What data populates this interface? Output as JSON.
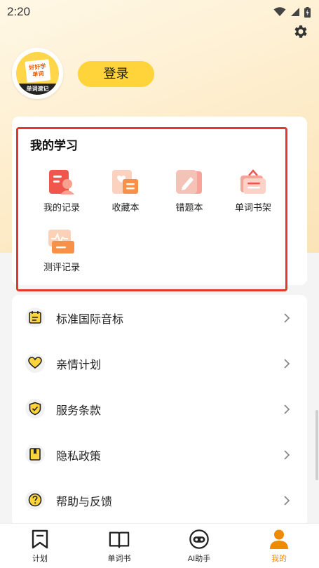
{
  "status_bar": {
    "time": "2:20"
  },
  "profile": {
    "avatar_top_text": "好好学",
    "avatar_mid_text": "单词",
    "avatar_band_text": "单词速记",
    "login_label": "登录"
  },
  "study": {
    "title": "我的学习",
    "items": [
      {
        "label": "我的记录",
        "icon": "record-icon"
      },
      {
        "label": "收藏本",
        "icon": "favorites-icon"
      },
      {
        "label": "错题本",
        "icon": "mistakes-icon"
      },
      {
        "label": "单词书架",
        "icon": "bookshelf-icon"
      },
      {
        "label": "测评记录",
        "icon": "assessment-icon"
      }
    ]
  },
  "menu": {
    "items": [
      {
        "label": "标准国际音标",
        "icon": "calendar-icon"
      },
      {
        "label": "亲情计划",
        "icon": "heart-icon"
      },
      {
        "label": "服务条款",
        "icon": "shield-check-icon"
      },
      {
        "label": "隐私政策",
        "icon": "bookmark-icon"
      },
      {
        "label": "帮助与反馈",
        "icon": "help-icon"
      }
    ]
  },
  "tabs": {
    "items": [
      {
        "label": "计划",
        "icon": "plan-icon"
      },
      {
        "label": "单词书",
        "icon": "book-icon"
      },
      {
        "label": "AI助手",
        "icon": "robot-icon"
      },
      {
        "label": "我的",
        "icon": "person-icon",
        "active": true
      }
    ]
  },
  "colors": {
    "accent": "#ffd43b",
    "active_tab": "#f08a00",
    "highlight_border": "#e5372b",
    "icon_red": "#f0564c",
    "icon_orange": "#f7914a"
  }
}
